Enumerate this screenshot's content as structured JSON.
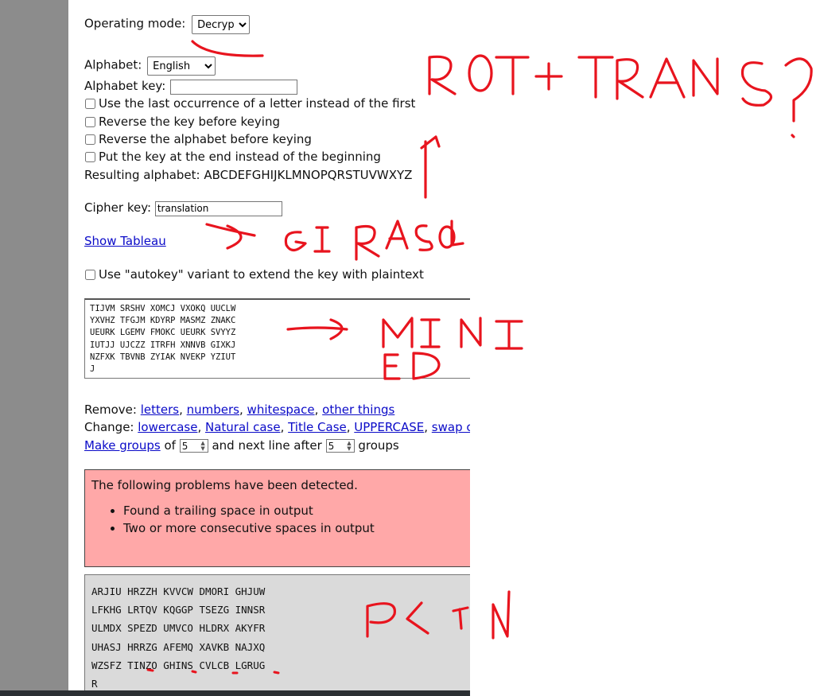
{
  "form": {
    "operating_mode_label": "Operating mode:",
    "operating_mode_value": "Decrypt",
    "alphabet_label": "Alphabet:",
    "alphabet_value": "English",
    "alphabet_key_label": "Alphabet key:",
    "alphabet_key_value": "",
    "options": [
      {
        "label": "Use the last occurrence of a letter instead of the first",
        "checked": false
      },
      {
        "label": "Reverse the key before keying",
        "checked": false
      },
      {
        "label": "Reverse the alphabet before keying",
        "checked": false
      },
      {
        "label": "Put the key at the end instead of the beginning",
        "checked": false
      }
    ],
    "resulting_alphabet_label": "Resulting alphabet:",
    "resulting_alphabet_value": "ABCDEFGHIJKLMNOPQRSTUVWXYZ",
    "cipher_key_label": "Cipher key:",
    "cipher_key_value": "translation",
    "show_tableau": "Show Tableau",
    "autokey_label": "Use \"autokey\" variant to extend the key with plaintext",
    "autokey_checked": false
  },
  "input_text": "TIJVM SRSHV XOMCJ VXOKQ UUCLW\nYXVHZ TFGJM KDYRP MASMZ ZNAKC\nUEURK LGEMV FMOKC UEURK SVYYZ\nIUTJJ UJCZZ ITRFH XNNVB GIXKJ\nNZFXK TBVNB ZYIAK NVEKP YZIUT\nJ",
  "tools": {
    "remove_label": "Remove:",
    "remove_links": [
      "letters",
      "numbers",
      "whitespace",
      "other things"
    ],
    "change_label": "Change:",
    "change_links": [
      "lowercase",
      "Natural case",
      "Title Case",
      "UPPERCASE",
      "swap case"
    ],
    "make_groups": "Make groups",
    "of_label": "of",
    "group_size": "5",
    "next_line_label": "and next line after",
    "groups_per_line": "5",
    "groups_label": "groups"
  },
  "problems": {
    "title": "The following problems have been detected.",
    "items": [
      "Found a trailing space in output",
      "Two or more consecutive spaces in output"
    ]
  },
  "output_text": "ARJIU HRZZH KVVCW DMORI GHJUW\nLFKHG LRTQV KQGGP TSEZG INNSR\nULMDX SPEZD UMVCO HLDRX AKYFR\nUHASJ HRRZG AFEMQ XAVKB NAJXQ\nWZSFZ TINZO GHINS CVLCB LGRUG\nR",
  "annotations": {
    "color": "#e8141e",
    "notes": [
      "ROT+TRANS?",
      "GIRASOL",
      "MIXED",
      "PLIN"
    ]
  }
}
